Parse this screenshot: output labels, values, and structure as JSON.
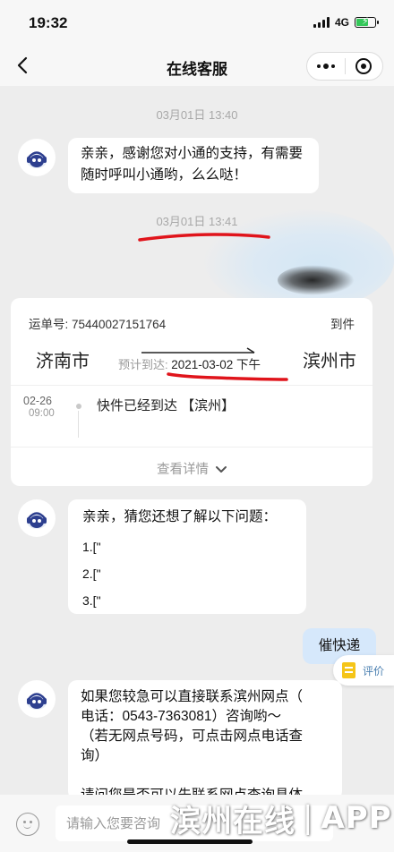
{
  "status_bar": {
    "time": "19:32",
    "network": "4G"
  },
  "nav": {
    "title": "在线客服"
  },
  "chat": {
    "timestamp1": "03月01日 13:40",
    "bot_message1": [
      "亲亲，感谢您对小通的支持，有需要",
      "随时呼叫小通哟，么么哒！"
    ],
    "timestamp2": "03月01日 13:41",
    "waybill": {
      "number_label": "运单号: 75440027151764",
      "status": "到件",
      "from_city": "济南市",
      "to_city": "滨州市",
      "eta_label": "预计到达:",
      "eta_date": "2021-03-02 下午",
      "track_date": "02-26",
      "track_time": "09:00",
      "track_text": "快件已经到达 【滨州】",
      "detail_link": "查看详情"
    },
    "bot_message2": {
      "intro": "亲亲，猜您还想了解以下问题：",
      "items": [
        "1.[\"",
        "2.[\"",
        "3.[\""
      ]
    },
    "user_message": "催快递",
    "rate_label": "评价",
    "bot_message3": [
      "如果您较急可以直接联系滨州网点（",
      "电话：0543-7363081）咨询哟～",
      "（若无网点号码，可点击网点电话查",
      "询）",
      "",
      "请问您是否可以先联系网点查询具体"
    ]
  },
  "input": {
    "placeholder": "请输入您要咨询"
  },
  "watermark": {
    "left": "滨州在线",
    "sep": "|",
    "right": "APP"
  },
  "colors": {
    "background": "#ededed",
    "bubble": "#ffffff",
    "user_bubble": "#d6e8fb",
    "annotation": "#e0141b",
    "battery": "#34c759"
  }
}
